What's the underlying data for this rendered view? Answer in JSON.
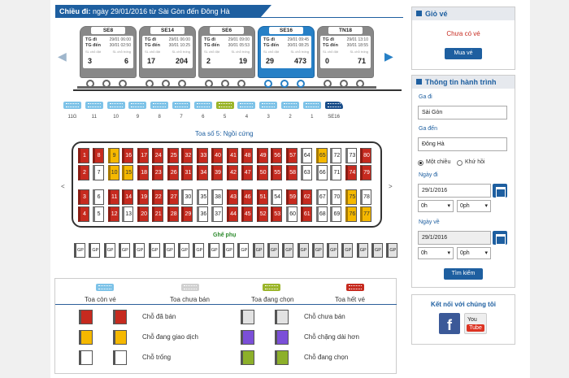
{
  "header": {
    "label": "Chiều đi:",
    "value": "ngày 29/01/2016 từ Sài Gòn đến Đông Hà"
  },
  "trains": [
    {
      "name": "SE8",
      "depart_label": "TG đi",
      "depart": "29/01 06:00",
      "arrive_label": "TG đến",
      "arrive": "30/01 02:50",
      "left_label": "SL chỗ đặt",
      "right_label": "SL chỗ trống",
      "booked": "3",
      "free": "6"
    },
    {
      "name": "SE14",
      "depart_label": "TG đi",
      "depart": "29/01 06:00",
      "arrive_label": "TG đến",
      "arrive": "30/01 10:25",
      "left_label": "SL chỗ đặt",
      "right_label": "SL chỗ trống",
      "booked": "17",
      "free": "204"
    },
    {
      "name": "SE6",
      "depart_label": "TG đi",
      "depart": "29/01 09:00",
      "arrive_label": "TG đến",
      "arrive": "30/01 05:53",
      "left_label": "SL chỗ đặt",
      "right_label": "SL chỗ trống",
      "booked": "2",
      "free": "19"
    },
    {
      "name": "SE16",
      "depart_label": "TG đi",
      "depart": "29/01 09:45",
      "arrive_label": "TG đến",
      "arrive": "30/01 08:25",
      "left_label": "SL chỗ đặt",
      "right_label": "SL chỗ trống",
      "booked": "29",
      "free": "473"
    },
    {
      "name": "TN18",
      "depart_label": "TG đi",
      "depart": "29/01 13:10",
      "arrive_label": "TG đến",
      "arrive": "30/01 18:55",
      "left_label": "SL chỗ đặt",
      "right_label": "SL chỗ trống",
      "booked": "0",
      "free": "71"
    }
  ],
  "carriages": [
    {
      "label": "11G",
      "state": "available"
    },
    {
      "label": "11",
      "state": "available"
    },
    {
      "label": "10",
      "state": "available"
    },
    {
      "label": "9",
      "state": "available"
    },
    {
      "label": "8",
      "state": "available"
    },
    {
      "label": "7",
      "state": "available"
    },
    {
      "label": "6",
      "state": "available"
    },
    {
      "label": "5",
      "state": "chosen"
    },
    {
      "label": "4",
      "state": "available"
    },
    {
      "label": "3",
      "state": "available"
    },
    {
      "label": "2",
      "state": "available"
    },
    {
      "label": "1",
      "state": "available"
    },
    {
      "label": "SE16",
      "state": "loco"
    }
  ],
  "coach_title": "Toa số 5: Ngồi cứng",
  "seats": [
    {
      "n": "1",
      "s": "sold"
    },
    {
      "n": "8",
      "s": "sold"
    },
    {
      "n": "9",
      "s": "busy"
    },
    {
      "n": "16",
      "s": "sold"
    },
    {
      "n": "17",
      "s": "sold"
    },
    {
      "n": "24",
      "s": "sold"
    },
    {
      "n": "25",
      "s": "sold"
    },
    {
      "n": "32",
      "s": "sold"
    },
    {
      "n": "33",
      "s": "sold"
    },
    {
      "n": "40",
      "s": "sold"
    },
    {
      "n": "41",
      "s": "sold"
    },
    {
      "n": "48",
      "s": "sold"
    },
    {
      "n": "49",
      "s": "sold"
    },
    {
      "n": "56",
      "s": "sold"
    },
    {
      "n": "57",
      "s": "sold"
    },
    {
      "n": "64",
      "s": "free"
    },
    {
      "n": "65",
      "s": "busy"
    },
    {
      "n": "72",
      "s": "free"
    },
    {
      "n": "73",
      "s": "free"
    },
    {
      "n": "80",
      "s": "sold"
    },
    {
      "n": "2",
      "s": "sold"
    },
    {
      "n": "7",
      "s": "free"
    },
    {
      "n": "10",
      "s": "busy"
    },
    {
      "n": "15",
      "s": "busy"
    },
    {
      "n": "18",
      "s": "sold"
    },
    {
      "n": "23",
      "s": "sold"
    },
    {
      "n": "26",
      "s": "sold"
    },
    {
      "n": "31",
      "s": "sold"
    },
    {
      "n": "34",
      "s": "sold"
    },
    {
      "n": "39",
      "s": "sold"
    },
    {
      "n": "42",
      "s": "sold"
    },
    {
      "n": "47",
      "s": "sold"
    },
    {
      "n": "50",
      "s": "sold"
    },
    {
      "n": "55",
      "s": "sold"
    },
    {
      "n": "58",
      "s": "sold"
    },
    {
      "n": "63",
      "s": "free"
    },
    {
      "n": "66",
      "s": "free"
    },
    {
      "n": "71",
      "s": "free"
    },
    {
      "n": "74",
      "s": "sold"
    },
    {
      "n": "79",
      "s": "sold"
    },
    {
      "n": "3",
      "s": "sold"
    },
    {
      "n": "6",
      "s": "free"
    },
    {
      "n": "11",
      "s": "sold"
    },
    {
      "n": "14",
      "s": "sold"
    },
    {
      "n": "19",
      "s": "sold"
    },
    {
      "n": "22",
      "s": "sold"
    },
    {
      "n": "27",
      "s": "sold"
    },
    {
      "n": "30",
      "s": "free"
    },
    {
      "n": "35",
      "s": "free"
    },
    {
      "n": "38",
      "s": "free"
    },
    {
      "n": "43",
      "s": "sold"
    },
    {
      "n": "46",
      "s": "sold"
    },
    {
      "n": "51",
      "s": "sold"
    },
    {
      "n": "54",
      "s": "free"
    },
    {
      "n": "59",
      "s": "sold"
    },
    {
      "n": "62",
      "s": "sold"
    },
    {
      "n": "67",
      "s": "free"
    },
    {
      "n": "70",
      "s": "free"
    },
    {
      "n": "75",
      "s": "busy"
    },
    {
      "n": "78",
      "s": "free"
    },
    {
      "n": "4",
      "s": "sold"
    },
    {
      "n": "5",
      "s": "free"
    },
    {
      "n": "12",
      "s": "sold"
    },
    {
      "n": "13",
      "s": "free"
    },
    {
      "n": "20",
      "s": "sold"
    },
    {
      "n": "21",
      "s": "sold"
    },
    {
      "n": "28",
      "s": "sold"
    },
    {
      "n": "29",
      "s": "sold"
    },
    {
      "n": "36",
      "s": "free"
    },
    {
      "n": "37",
      "s": "free"
    },
    {
      "n": "44",
      "s": "sold"
    },
    {
      "n": "45",
      "s": "sold"
    },
    {
      "n": "52",
      "s": "sold"
    },
    {
      "n": "53",
      "s": "sold"
    },
    {
      "n": "60",
      "s": "free"
    },
    {
      "n": "61",
      "s": "sold"
    },
    {
      "n": "68",
      "s": "free"
    },
    {
      "n": "69",
      "s": "free"
    },
    {
      "n": "76",
      "s": "busy"
    },
    {
      "n": "77",
      "s": "busy"
    }
  ],
  "aux_label": "Ghế phụ",
  "aux_seat_label": "GP",
  "aux_states": [
    "free",
    "free",
    "free",
    "free",
    "free",
    "free",
    "free",
    "free",
    "free",
    "free",
    "free",
    "free",
    "other",
    "other",
    "other",
    "other",
    "other",
    "other",
    "other",
    "other",
    "other",
    "other"
  ],
  "legend": {
    "carriages": [
      {
        "label": "Toa còn vé",
        "color": "#7ec3e8"
      },
      {
        "label": "Toa chưa bán",
        "color": "#d0d0d0"
      },
      {
        "label": "Toa đang chọn",
        "color": "#9bb52a"
      },
      {
        "label": "Toa hết vé",
        "color": "#c62a1f"
      }
    ],
    "seats": [
      {
        "label": "Chỗ đã bán",
        "color": "#c62a1f"
      },
      {
        "label": "Chỗ đang giao dịch",
        "color": "#f5b800"
      },
      {
        "label": "Chỗ trống",
        "color": "#ffffff"
      },
      {
        "label": "Chỗ chưa bán",
        "color": "#e2e2e2"
      },
      {
        "label": "Chỗ chặng dài hơn",
        "color": "#7b4fd8"
      },
      {
        "label": "Chỗ đang chọn",
        "color": "#8db02a"
      }
    ]
  },
  "cart": {
    "title": "Giỏ vé",
    "empty": "Chưa có vé",
    "buy": "Mua vé"
  },
  "trip": {
    "title": "Thông tin hành trình",
    "from_label": "Ga đi",
    "from": "Sài Gòn",
    "to_label": "Ga đến",
    "to": "Đông Hà",
    "oneway": "Một chiều",
    "roundtrip": "Khứ hồi",
    "depart_label": "Ngày đi",
    "depart_date": "29/1/2016",
    "depart_hour1": "0h",
    "depart_hour2": "0ph",
    "return_label": "Ngày về",
    "return_date": "29/1/2016",
    "return_hour1": "0h",
    "return_hour2": "0ph",
    "search": "Tìm kiếm"
  },
  "social": {
    "title": "Kết nối với chúng tôi",
    "fb": "f",
    "yt_top": "You",
    "yt_bottom": "Tube"
  },
  "colors": {
    "primary": "#1e5fa0",
    "sold": "#c62a1f",
    "busy": "#f5b800",
    "available": "#7ec3e8",
    "chosen": "#9bb52a"
  }
}
